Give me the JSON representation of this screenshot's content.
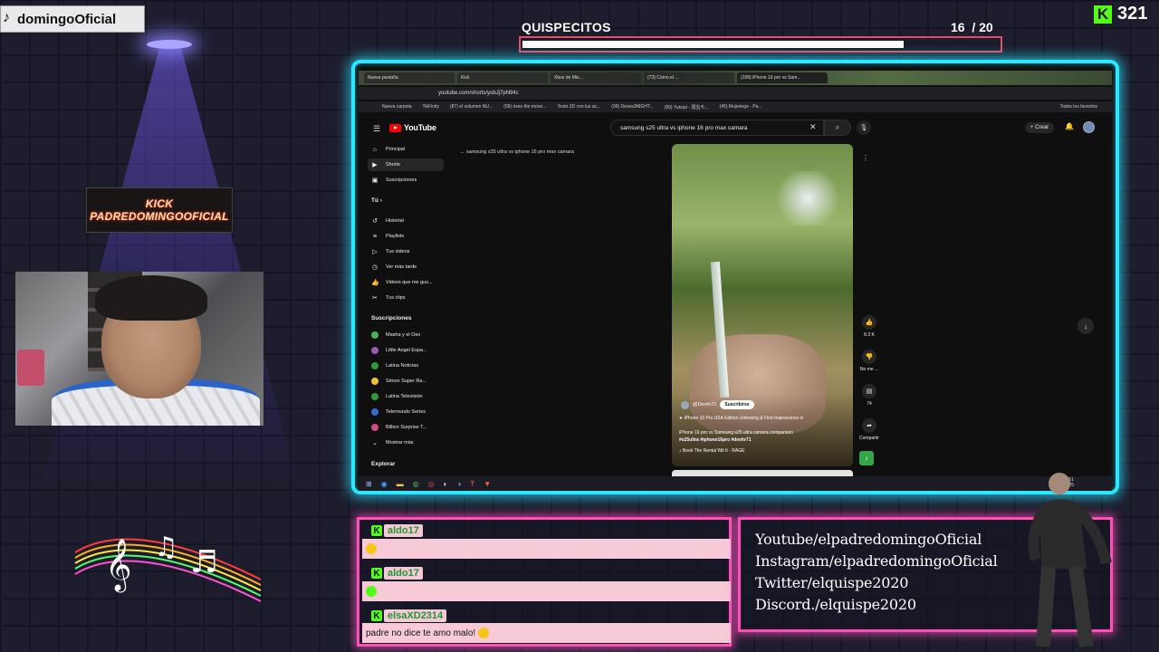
{
  "overlay": {
    "handle": "domingoOficial",
    "goal": {
      "title": "QUISPECITOS",
      "current": "16",
      "sep": "/",
      "total": "20",
      "progress_fraction": 0.8
    },
    "kick_count": "321",
    "kick_banner": {
      "line1": "KICK",
      "line2": "PADREDOMINGOOFICIAL"
    },
    "socials": [
      "Youtube/elpadredomingoOficial",
      "Instagram/elpadredomingoOficial",
      "Twitter/elquispe2020",
      "Discord./elquispe2020"
    ],
    "colors": {
      "frame_cyan": "#2ee6ff",
      "chat_pink": "#ff4fb8",
      "kick_green": "#53fc18",
      "goal_red": "#e44d6a"
    }
  },
  "chat": [
    {
      "user": "aldo17",
      "message": ""
    },
    {
      "user": "aldo17",
      "message": ""
    },
    {
      "user": "elsaXD2314",
      "message": "padre no dice te amo malo!"
    }
  ],
  "browser": {
    "tabs": [
      "Nueva pestaña",
      "Kick",
      "Xbox de Mis...",
      "(73) Cómo el ...",
      "(208) iPhone 16 pro vs Sam..."
    ],
    "url": "youtube.com/shorts/yobJj7pN94c",
    "bookmarks": [
      "Nueva carpeta",
      "TikFinity",
      "(87) el volumen NU...",
      "(58) rises the moon...",
      "Texto 3D con luz ac...",
      "(99) Deses3NIGHT...",
      "(99) Yukopi - 弱虫モ...",
      "(45) Mujeriego - Pa..."
    ],
    "bookmarks_right": "Todos los favoritos",
    "search_query": "samsung s25 ultra vs iphone 16 pro max camara",
    "create_label": "Crear",
    "logo_text": "YouTube",
    "breadcrumb": "samsung s25 ultra vs iphone 16 pro max camara",
    "sidebar": {
      "main": [
        "Principal",
        "Shorts",
        "Suscripciones"
      ],
      "you_header": "Tú",
      "you": [
        "Historial",
        "Playlists",
        "Tus videos",
        "Ver más tarde",
        "Videos que me gus...",
        "Tus clips"
      ],
      "subs_header": "Suscripciones",
      "subs": [
        {
          "name": "Masha y el Oso",
          "color": "#4caf50"
        },
        {
          "name": "Little Angel Espa...",
          "color": "#9b5ab8"
        },
        {
          "name": "Latina Noticias",
          "color": "#2e9b3a"
        },
        {
          "name": "Simon Super Ra...",
          "color": "#f2c12e"
        },
        {
          "name": "Latina Televisión",
          "color": "#2e9b3a"
        },
        {
          "name": "Telemundo Series",
          "color": "#3a6ad2"
        },
        {
          "name": "Billion Surprise T...",
          "color": "#d24a8a"
        }
      ],
      "show_more": "Mostrar más",
      "explore": "Explorar"
    },
    "short": {
      "channel": "@Devhr71",
      "subscribe": "Suscribirse",
      "line1": "iPhone 16 Pro USA Edition Unboxing & First Impressions in",
      "line2": "iPhone 16 pro vs Samsung s25 ultra camera comparison",
      "tags": "#s25ultra #iphone16pro #devhr71",
      "music": "Book The Rental Wit It · RAGE",
      "likes": "8.3 K",
      "dislike": "No me ...",
      "comments": "74",
      "share": "Compartir"
    },
    "clock": {
      "time": "14:51",
      "date": "20/07/2025"
    }
  }
}
